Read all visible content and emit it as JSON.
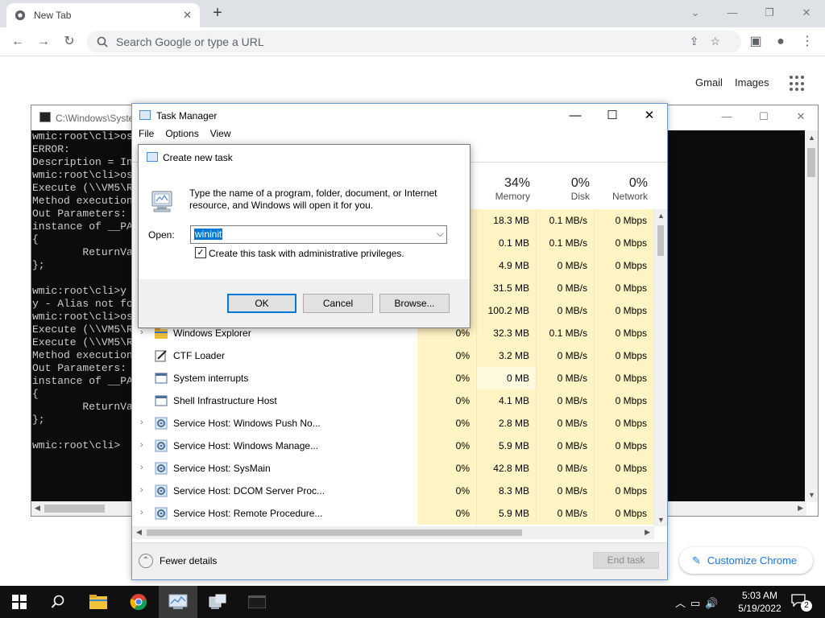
{
  "chrome": {
    "tab_title": "New Tab",
    "omnibox_placeholder": "Search Google or type a URL",
    "gmail": "Gmail",
    "images": "Images",
    "customize": "Customize Chrome"
  },
  "cmd": {
    "title": "C:\\Windows\\Syste",
    "lines": [
      "wmic:root\\cli>os",
      "ERROR:",
      "Description = In",
      "wmic:root\\cli>os",
      "Execute (\\\\VM5\\R",
      "Method execution",
      "Out Parameters:",
      "instance of __PA",
      "{",
      "        ReturnVa",
      "};",
      "",
      "wmic:root\\cli>y",
      "y - Alias not fo",
      "wmic:root\\cli>os",
      "Execute (\\\\VM5\\R",
      "Execute (\\\\VM5\\R",
      "Method execution",
      "Out Parameters:",
      "instance of __PA",
      "{",
      "        ReturnVa",
      "};",
      "",
      "wmic:root\\cli>"
    ]
  },
  "task_manager": {
    "title": "Task Manager",
    "menu": [
      "File",
      "Options",
      "View"
    ],
    "columns": {
      "memory": {
        "pct": "34%",
        "label": "Memory"
      },
      "disk": {
        "pct": "0%",
        "label": "Disk"
      },
      "network": {
        "pct": "0%",
        "label": "Network"
      }
    },
    "rows": [
      {
        "name": "",
        "cpu": "",
        "mem": "18.3 MB",
        "disk": "0.1 MB/s",
        "net": "0 Mbps",
        "icon": "none",
        "expand": false
      },
      {
        "name": "",
        "cpu": "",
        "mem": "0.1 MB",
        "disk": "0.1 MB/s",
        "net": "0 Mbps",
        "icon": "none",
        "expand": false
      },
      {
        "name": "",
        "cpu": "",
        "mem": "4.9 MB",
        "disk": "0 MB/s",
        "net": "0 Mbps",
        "icon": "none",
        "expand": false
      },
      {
        "name": "",
        "cpu": "",
        "mem": "31.5 MB",
        "disk": "0 MB/s",
        "net": "0 Mbps",
        "icon": "none",
        "expand": false
      },
      {
        "name": "",
        "cpu": "",
        "mem": "100.2 MB",
        "disk": "0 MB/s",
        "net": "0 Mbps",
        "icon": "none",
        "expand": false
      },
      {
        "name": "Windows Explorer",
        "cpu": "0%",
        "mem": "32.3 MB",
        "disk": "0.1 MB/s",
        "net": "0 Mbps",
        "icon": "folder-icon",
        "expand": true
      },
      {
        "name": "CTF Loader",
        "cpu": "0%",
        "mem": "3.2 MB",
        "disk": "0 MB/s",
        "net": "0 Mbps",
        "icon": "pen-icon",
        "expand": false
      },
      {
        "name": "System interrupts",
        "cpu": "0%",
        "mem": "0 MB",
        "disk": "0 MB/s",
        "net": "0 Mbps",
        "icon": "window-icon",
        "expand": false
      },
      {
        "name": "Shell Infrastructure Host",
        "cpu": "0%",
        "mem": "4.1 MB",
        "disk": "0 MB/s",
        "net": "0 Mbps",
        "icon": "window-icon",
        "expand": false
      },
      {
        "name": "Service Host: Windows Push No...",
        "cpu": "0%",
        "mem": "2.8 MB",
        "disk": "0 MB/s",
        "net": "0 Mbps",
        "icon": "gear-icon",
        "expand": true
      },
      {
        "name": "Service Host: Windows Manage...",
        "cpu": "0%",
        "mem": "5.9 MB",
        "disk": "0 MB/s",
        "net": "0 Mbps",
        "icon": "gear-icon",
        "expand": true
      },
      {
        "name": "Service Host: SysMain",
        "cpu": "0%",
        "mem": "42.8 MB",
        "disk": "0 MB/s",
        "net": "0 Mbps",
        "icon": "gear-icon",
        "expand": true
      },
      {
        "name": "Service Host: DCOM Server Proc...",
        "cpu": "0%",
        "mem": "8.3 MB",
        "disk": "0 MB/s",
        "net": "0 Mbps",
        "icon": "gear-icon",
        "expand": true
      },
      {
        "name": "Service Host: Remote Procedure...",
        "cpu": "0%",
        "mem": "5.9 MB",
        "disk": "0 MB/s",
        "net": "0 Mbps",
        "icon": "gear-icon",
        "expand": true
      }
    ],
    "fewer_details": "Fewer details",
    "end_task": "End task"
  },
  "dialog": {
    "title": "Create new task",
    "description": "Type the name of a program, folder, document, or Internet resource, and Windows will open it for you.",
    "open_label": "Open:",
    "open_value": "wininit",
    "admin_checked": true,
    "admin_label": "Create this task with administrative privileges.",
    "ok": "OK",
    "cancel": "Cancel",
    "browse": "Browse..."
  },
  "taskbar": {
    "time": "5:03 AM",
    "date": "5/19/2022",
    "notifications": "2"
  }
}
